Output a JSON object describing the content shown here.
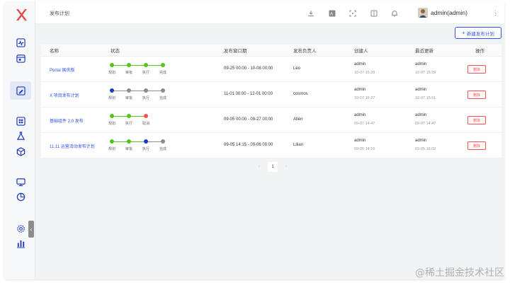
{
  "app": {
    "page_title": "发布计划",
    "user": "admin(admin)"
  },
  "toolbar": {
    "new_label": "新建发布计划"
  },
  "colors": {
    "green": "#52c41a",
    "gray": "#8c8c8c",
    "blue": "#1d39c4",
    "red": "#ff4d4f",
    "accent": "#2f54eb"
  },
  "columns": [
    "名称",
    "状态",
    "发布窗口期",
    "发布负责人",
    "创建人",
    "最近更新",
    "操作"
  ],
  "rows": [
    {
      "name": "Portal 国庆版",
      "window": "09-25 00:00 - 10-08 00:00",
      "owner": "Leo",
      "creator": "admin",
      "created": "10-07 15:28",
      "updater": "admin",
      "updated": "10-07 15:29",
      "action": "删除",
      "steps": [
        {
          "label": "规划",
          "state": "green"
        },
        {
          "label": "审批",
          "state": "green"
        },
        {
          "label": "执行",
          "state": "green"
        },
        {
          "label": "完成",
          "state": "green"
        }
      ]
    },
    {
      "name": "X 项目发布计划",
      "window": "11-01 00:00 - 12-01 00:00",
      "owner": "cosmos",
      "creator": "admin",
      "created": "10-07 15:27",
      "updater": "admin",
      "updated": "10-07 15:51",
      "action": "删除",
      "steps": [
        {
          "label": "规划",
          "state": "blue"
        },
        {
          "label": "审批",
          "state": "gray"
        },
        {
          "label": "执行",
          "state": "gray"
        },
        {
          "label": "完成",
          "state": "gray"
        }
      ]
    },
    {
      "name": "基础组件 2.0 发布",
      "window": "09-05 00:00 - 09-27 00:00",
      "owner": "Allen",
      "creator": "admin",
      "created": "09-07 14:47",
      "updater": "admin",
      "updated": "09-07 14:47",
      "action": "删除",
      "steps": [
        {
          "label": "规划",
          "state": "green"
        },
        {
          "label": "执行",
          "state": "green"
        },
        {
          "label": "取消",
          "state": "red"
        }
      ]
    },
    {
      "name": "11.11 运营活动发布计划",
      "window": "09-05 14:15 - 09-06 00:00",
      "owner": "Lilian",
      "creator": "admin",
      "created": "09-05 14:16",
      "updater": "admin",
      "updated": "09-05 16:02",
      "action": "删除",
      "steps": [
        {
          "label": "规划",
          "state": "green"
        },
        {
          "label": "审批",
          "state": "green"
        },
        {
          "label": "执行",
          "state": "blue"
        },
        {
          "label": "完成",
          "state": "gray"
        }
      ]
    }
  ],
  "pagination": {
    "prev": "‹",
    "current": "1",
    "next": "›"
  },
  "watermark": "@稀土掘金技术社区"
}
